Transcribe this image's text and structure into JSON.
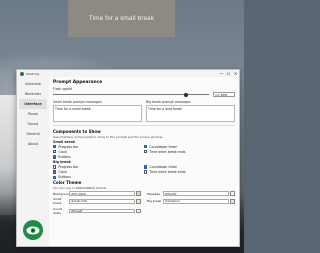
{
  "break_prompt": {
    "text": "Time for a small break"
  },
  "window": {
    "title": "Stretchly",
    "controls": {
      "minimize": "—",
      "maximize": "☐",
      "close": "✕"
    }
  },
  "sidebar": {
    "items": [
      {
        "label": "Schedule",
        "active": false
      },
      {
        "label": "Reminder",
        "active": false
      },
      {
        "label": "Interface",
        "active": true
      },
      {
        "label": "Pause",
        "active": false
      },
      {
        "label": "Sound",
        "active": false
      },
      {
        "label": "General",
        "active": false
      },
      {
        "label": "About",
        "active": false
      }
    ]
  },
  "prompt_appearance": {
    "heading": "Prompt Appearance",
    "flash_speed_label": "Flash speed",
    "flash_speed_value": 0.85,
    "flash_speed_select": "1/2 BPM",
    "small_messages_label": "Small break prompt messages",
    "big_messages_label": "Big break prompt messages",
    "small_message_value": "Time for a small break",
    "big_message_value": "Time for a long break"
  },
  "components": {
    "heading": "Components to Show",
    "description": "Use interface components to show to the prompt and full screen window.",
    "small_break": {
      "heading": "Small break",
      "items": [
        {
          "label": "Progress bar",
          "checked": true
        },
        {
          "label": "Countdown timer",
          "checked": true
        },
        {
          "label": "Clock",
          "checked": false
        },
        {
          "label": "Time when break ends",
          "checked": false
        },
        {
          "label": "Buttons",
          "checked": true
        }
      ]
    },
    "big_break": {
      "heading": "Big break",
      "items": [
        {
          "label": "Progress bar",
          "checked": false
        },
        {
          "label": "Countdown timer",
          "checked": true
        },
        {
          "label": "Clock",
          "checked": true
        },
        {
          "label": "Time when break ends",
          "checked": false
        },
        {
          "label": "Buttons",
          "checked": true
        }
      ]
    }
  },
  "color_theme": {
    "heading": "Color Theme",
    "description": "All color are in #RRGGBBAA format",
    "fields": [
      {
        "label": "Background",
        "value": "#ffCca8A0",
        "color": "#ffcca8"
      },
      {
        "label": "Message",
        "value": "#ffeeff0",
        "color": "#ffeeff"
      },
      {
        "label": "Small break",
        "value": "#ebebcbdb",
        "color": "#ebebcb"
      },
      {
        "label": "Big break",
        "value": "#ebebbad",
        "color": "#ebebba"
      },
      {
        "label": "Count down",
        "value": "#ffeaeff",
        "color": "#ffeaef"
      }
    ]
  }
}
